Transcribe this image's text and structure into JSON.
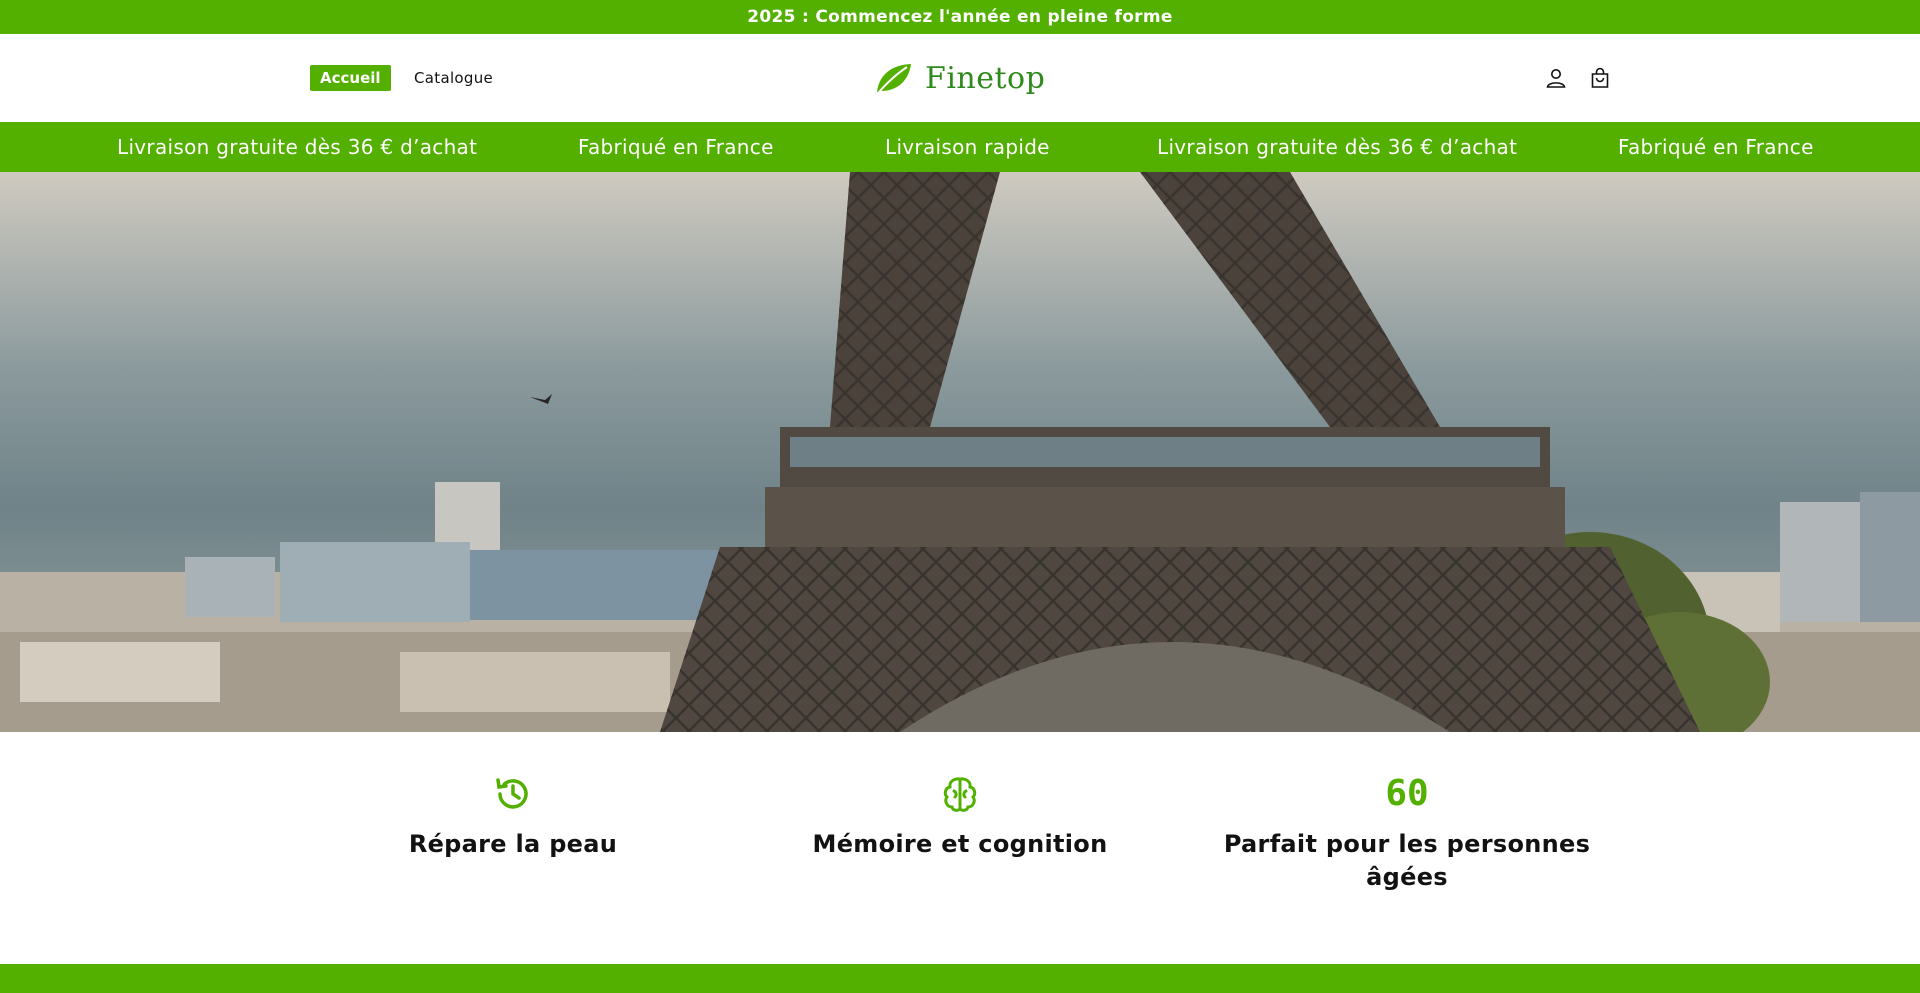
{
  "announcement": {
    "text": "2025 : Commencez l'année en pleine forme"
  },
  "header": {
    "nav": [
      {
        "label": "Accueil",
        "active": true
      },
      {
        "label": "Catalogue",
        "active": false
      }
    ],
    "logo_text": "Finetop",
    "icons": [
      "account-icon",
      "cart-icon"
    ]
  },
  "marquee": {
    "items": [
      "Livraison gratuite dès 36 € d’achat",
      "Fabriqué en France",
      "Livraison rapide",
      "Livraison gratuite dès 36 € d’achat",
      "Fabriqué en France"
    ]
  },
  "features": [
    {
      "icon": "history-icon",
      "title": "Répare la peau"
    },
    {
      "icon": "brain-icon",
      "title": "Mémoire et cognition"
    },
    {
      "icon_text": "60",
      "title": "Parfait pour les personnes âgées"
    }
  ],
  "colors": {
    "brand_green": "#53b000",
    "logo_green": "#2f8a1c",
    "text": "#121212"
  }
}
